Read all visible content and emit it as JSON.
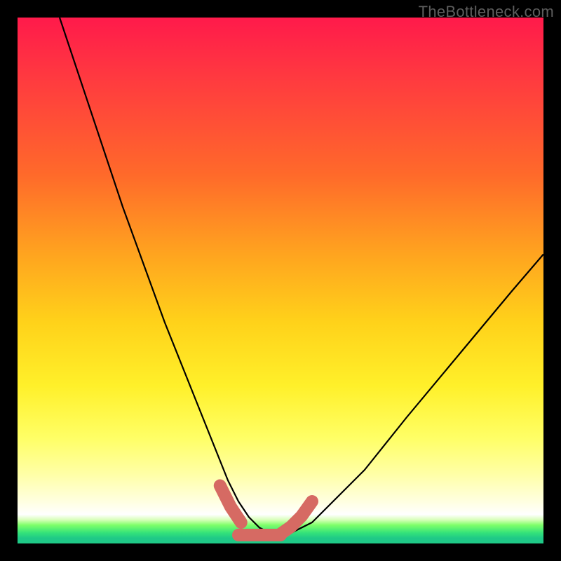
{
  "watermark": "TheBottleneck.com",
  "chart_data": {
    "type": "line",
    "title": "",
    "xlabel": "",
    "ylabel": "",
    "xlim": [
      0,
      100
    ],
    "ylim": [
      0,
      100
    ],
    "grid": false,
    "series": [
      {
        "name": "black-curve",
        "stroke": "#000000",
        "stroke_width": 2.2,
        "x": [
          8,
          12,
          16,
          20,
          24,
          28,
          32,
          36,
          38,
          40,
          42,
          44,
          46,
          48,
          50,
          52,
          56,
          60,
          66,
          74,
          84,
          94,
          100
        ],
        "values": [
          100,
          88,
          76,
          64,
          53,
          42,
          32,
          22,
          17,
          12,
          8,
          5,
          3,
          2,
          2,
          2,
          4,
          8,
          14,
          24,
          36,
          48,
          55
        ]
      },
      {
        "name": "pink-marker-left",
        "stroke": "#d66a63",
        "stroke_width": 18,
        "linecap": "round",
        "x": [
          38.5,
          40.5,
          42.5
        ],
        "values": [
          11,
          7,
          4
        ]
      },
      {
        "name": "pink-marker-bottom",
        "stroke": "#d66a63",
        "stroke_width": 18,
        "linecap": "round",
        "x": [
          42.0,
          46.0,
          50.0
        ],
        "values": [
          1.6,
          1.6,
          1.6
        ]
      },
      {
        "name": "pink-marker-right",
        "stroke": "#d66a63",
        "stroke_width": 18,
        "linecap": "round",
        "x": [
          50.0,
          52.0,
          54.0,
          56.0
        ],
        "values": [
          1.8,
          3.2,
          5.2,
          8.0
        ]
      }
    ],
    "background": {
      "type": "vertical-gradient",
      "stops": [
        {
          "pos": 0.0,
          "color": "#ff1a4b"
        },
        {
          "pos": 0.3,
          "color": "#ff6a2a"
        },
        {
          "pos": 0.58,
          "color": "#ffd21a"
        },
        {
          "pos": 0.8,
          "color": "#ffff66"
        },
        {
          "pos": 0.94,
          "color": "#ffffff"
        },
        {
          "pos": 0.97,
          "color": "#7fff6a"
        },
        {
          "pos": 1.0,
          "color": "#1fc987"
        }
      ]
    }
  }
}
